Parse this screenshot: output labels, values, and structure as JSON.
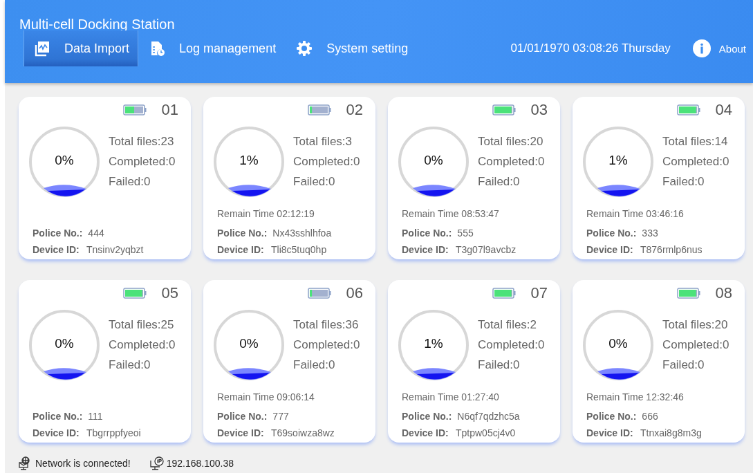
{
  "window": {
    "title": "Multi-cell Docking Station"
  },
  "tabs": [
    {
      "label": "Data Import",
      "selected": true
    },
    {
      "label": "Log management",
      "selected": false
    },
    {
      "label": "System setting",
      "selected": false
    }
  ],
  "datetime": "01/01/1970 03:08:26 Thursday",
  "about": {
    "label": "About"
  },
  "cells": [
    {
      "number": "01",
      "kind": "half",
      "percent": "0%",
      "total": "Total files:23",
      "completed": "Completed:0",
      "failed": "Failed:0",
      "police_label": "Police No.:",
      "police": "444",
      "device_label": "Device ID:",
      "device": "Tnsinv2yqbzt"
    },
    {
      "number": "02",
      "kind": "low",
      "percent": "1%",
      "total": "Total files:3",
      "completed": "Completed:0",
      "failed": "Failed:0",
      "remain": "Remain Time 02:12:19",
      "police_label": "Police No.:",
      "police": "Nx43sshlhfoa",
      "device_label": "Device ID:",
      "device": "Tli8c5tuq0hp"
    },
    {
      "number": "03",
      "kind": "full",
      "percent": "0%",
      "total": "Total files:20",
      "completed": "Completed:0",
      "failed": "Failed:0",
      "remain": "Remain Time 08:53:47",
      "police_label": "Police No.:",
      "police": "555",
      "device_label": "Device ID:",
      "device": "T3g07l9avcbz"
    },
    {
      "number": "04",
      "kind": "full",
      "percent": "1%",
      "total": "Total files:14",
      "completed": "Completed:0",
      "failed": "Failed:0",
      "remain": "Remain Time 03:46:16",
      "police_label": "Police No.:",
      "police": "333",
      "device_label": "Device ID:",
      "device": "T876rmlp6nus"
    },
    {
      "number": "05",
      "kind": "full",
      "percent": "0%",
      "total": "Total files:25",
      "completed": "Completed:0",
      "failed": "Failed:0",
      "police_label": "Police No.:",
      "police": "111",
      "device_label": "Device ID:",
      "device": "Tbgrrppfyeoi"
    },
    {
      "number": "06",
      "kind": "low",
      "percent": "0%",
      "total": "Total files:36",
      "completed": "Completed:0",
      "failed": "Failed:0",
      "remain": "Remain Time 09:06:14",
      "police_label": "Police No.:",
      "police": "777",
      "device_label": "Device ID:",
      "device": "T69soiwza8wz"
    },
    {
      "number": "07",
      "kind": "full",
      "percent": "1%",
      "total": "Total files:2",
      "completed": "Completed:0",
      "failed": "Failed:0",
      "remain": "Remain Time 01:27:40",
      "police_label": "Police No.:",
      "police": "N6qf7qdzhc5a",
      "device_label": "Device ID:",
      "device": "Tptpw05cj4v0"
    },
    {
      "number": "08",
      "kind": "full",
      "percent": "0%",
      "total": "Total files:20",
      "completed": "Completed:0",
      "failed": "Failed:0",
      "remain": "Remain Time 12:32:46",
      "police_label": "Police No.:",
      "police": "666",
      "device_label": "Device ID:",
      "device": "Ttnxai8g8m3g"
    }
  ],
  "status_bar": {
    "network": "Network is connected!",
    "ip": "192.168.100.38"
  }
}
